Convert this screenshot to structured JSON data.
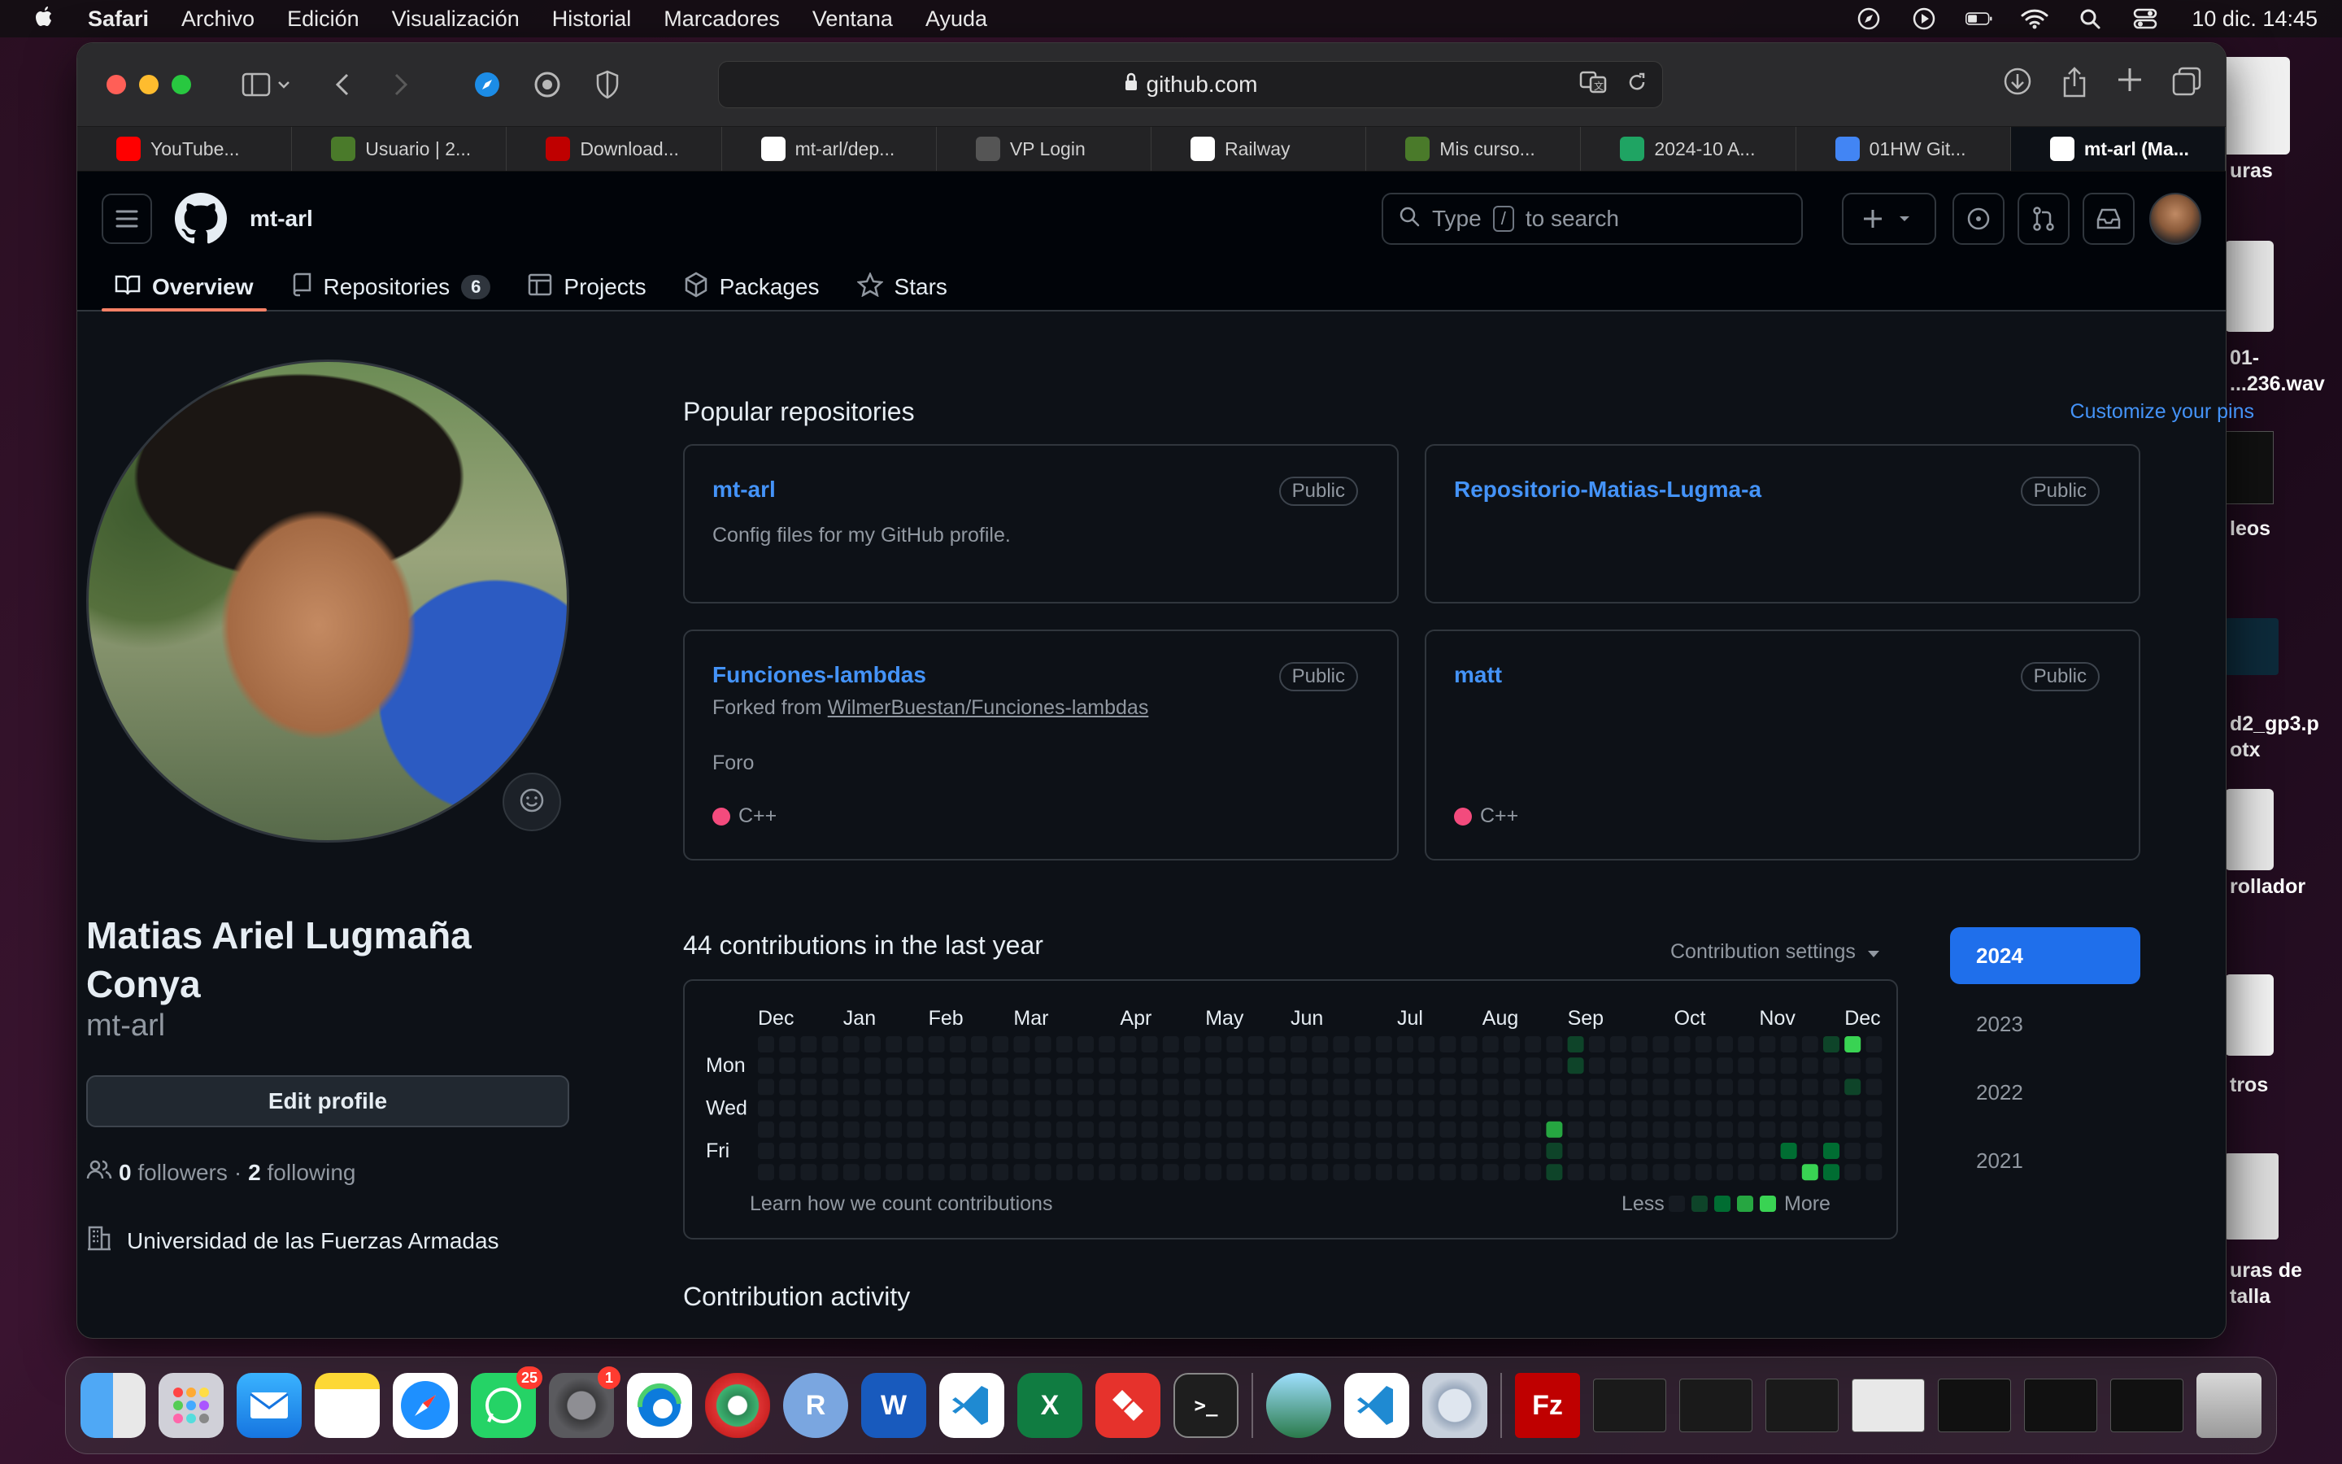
{
  "menubar": {
    "app": "Safari",
    "items": [
      "Archivo",
      "Edición",
      "Visualización",
      "Historial",
      "Marcadores",
      "Ventana",
      "Ayuda"
    ],
    "clock": "10 dic.  14:45"
  },
  "desktop": {
    "items": [
      "uras",
      "01-\n...236.wav",
      "leos",
      "d2_gp3.p\notx",
      "rollador",
      "tros",
      "uras de\ntalla"
    ]
  },
  "browser": {
    "url": "github.com",
    "tabs": [
      {
        "label": "YouTube...",
        "icon": "youtube-icon",
        "color": "#ff0000"
      },
      {
        "label": "Usuario | 2...",
        "icon": "university-icon",
        "color": "#4a7a2a"
      },
      {
        "label": "Download...",
        "icon": "filezilla-icon",
        "color": "#bf0000"
      },
      {
        "label": "mt-arl/dep...",
        "icon": "github-icon",
        "color": "#ffffff"
      },
      {
        "label": "VP Login",
        "icon": "b-icon",
        "color": "#555555"
      },
      {
        "label": "Railway",
        "icon": "railway-icon",
        "color": "#ffffff"
      },
      {
        "label": "Mis curso...",
        "icon": "university-icon",
        "color": "#4a7a2a"
      },
      {
        "label": "2024-10 A...",
        "icon": "google-drive-icon",
        "color": "#1fa463"
      },
      {
        "label": "01HW Git...",
        "icon": "google-docs-icon",
        "color": "#4285f4"
      },
      {
        "label": "mt-arl (Ma...",
        "icon": "github-icon",
        "color": "#ffffff"
      }
    ]
  },
  "github": {
    "username_header": "mt-arl",
    "search_before": "Type",
    "search_key": "/",
    "search_after": "to search",
    "nav": {
      "overview": "Overview",
      "repositories": "Repositories",
      "repositories_count": "6",
      "projects": "Projects",
      "packages": "Packages",
      "stars": "Stars"
    },
    "profile": {
      "name": "Matias Ariel Lugmaña Conya",
      "login": "mt-arl",
      "edit_label": "Edit profile",
      "followers_count": "0",
      "followers_label": "followers",
      "separator": "·",
      "following_count": "2",
      "following_label": "following",
      "organization": "Universidad de las Fuerzas Armadas"
    },
    "popular": {
      "title": "Popular repositories",
      "customize": "Customize your pins",
      "repos": [
        {
          "name": "mt-arl",
          "badge": "Public",
          "description": "Config files for my GitHub profile."
        },
        {
          "name": "Repositorio-Matias-Lugma-a",
          "badge": "Public"
        },
        {
          "name": "Funciones-lambdas",
          "badge": "Public",
          "forked_prefix": "Forked from",
          "forked_from": "WilmerBuestan/Funciones-lambdas",
          "description": "Foro",
          "language": "C++"
        },
        {
          "name": "matt",
          "badge": "Public",
          "language": "C++"
        }
      ]
    },
    "contributions": {
      "title": "44 contributions in the last year",
      "settings": "Contribution settings",
      "months": [
        "Dec",
        "Jan",
        "Feb",
        "Mar",
        "Apr",
        "May",
        "Jun",
        "Jul",
        "Aug",
        "Sep",
        "Oct",
        "Nov",
        "Dec"
      ],
      "days": [
        "Mon",
        "Wed",
        "Fri"
      ],
      "learn": "Learn how we count contributions",
      "less": "Less",
      "more": "More",
      "colors": [
        "#161b22",
        "#0e4429",
        "#006d32",
        "#26a641",
        "#39d353"
      ],
      "cells": [
        {
          "week": 38,
          "day": 0,
          "level": 1
        },
        {
          "week": 38,
          "day": 1,
          "level": 1
        },
        {
          "week": 37,
          "day": 4,
          "level": 3
        },
        {
          "week": 37,
          "day": 5,
          "level": 1
        },
        {
          "week": 37,
          "day": 6,
          "level": 1
        },
        {
          "week": 48,
          "day": 5,
          "level": 2
        },
        {
          "week": 49,
          "day": 6,
          "level": 4
        },
        {
          "week": 50,
          "day": 6,
          "level": 2
        },
        {
          "week": 50,
          "day": 5,
          "level": 2
        },
        {
          "week": 50,
          "day": 0,
          "level": 1
        },
        {
          "week": 51,
          "day": 0,
          "level": 4
        },
        {
          "week": 51,
          "day": 2,
          "level": 1
        }
      ]
    },
    "years": [
      "2024",
      "2023",
      "2022",
      "2021"
    ],
    "activity_title": "Contribution activity"
  },
  "dock": {
    "whatsapp_badge": "25",
    "settings_badge": "1"
  }
}
